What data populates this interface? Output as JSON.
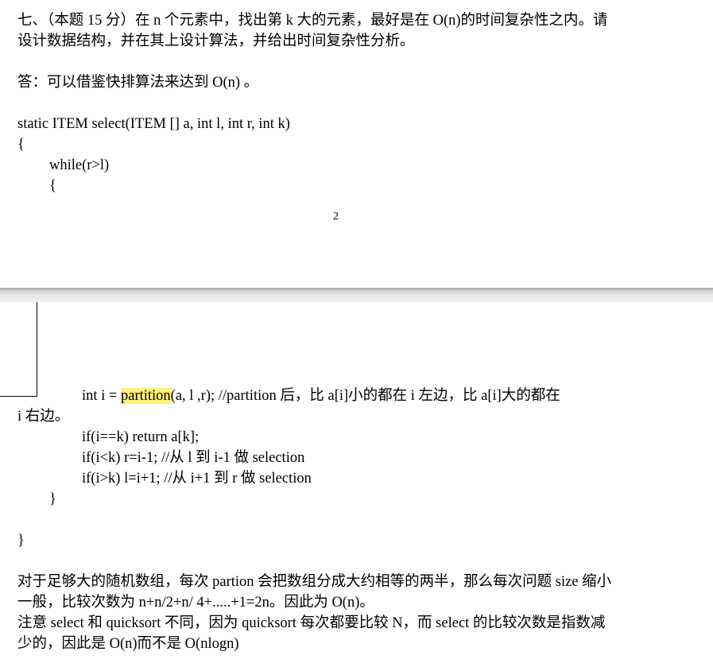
{
  "page1": {
    "question_line1": "七、（本题 15 分）在 n 个元素中，找出第 k 大的元素，最好是在 O(n)的时间复杂性之内。请",
    "question_line2": "设计数据结构，并在其上设计算法，并给出时间复杂性分析。",
    "answer_line": "答：可以借鉴快排算法来达到 O(n) 。",
    "code_signature": "static ITEM select(ITEM [] a, int l, int r, int k)",
    "code_open_brace": "{",
    "code_while": "while(r>l)",
    "code_while_brace": "{",
    "page_number": "2"
  },
  "page2": {
    "code_partition_prefix": "int i = ",
    "code_partition_highlight": "partition",
    "code_partition_suffix": "(a, l ,r); //partition 后，比 a[i]小的都在 i 左边，比 a[i]大的都在",
    "code_partition_wrap": "i 右边。",
    "code_if_equal": "if(i==k) return a[k];",
    "code_if_less": "if(i<k) r=i-1; //从 l 到 i-1 做 selection",
    "code_if_greater": "if(i>k) l=i+1; //从 i+1 到 r 做 selection",
    "code_close_inner": "}",
    "code_close_outer": "}",
    "analysis_line1": "对于足够大的随机数组，每次 partion 会把数组分成大约相等的两半，那么每次问题 size 缩小",
    "analysis_line2": "一般，比较次数为 n+n/2+n/ 4+.....+1=2n。因此为 O(n)。",
    "analysis_line3": "注意 select 和 quicksort 不同，因为 quicksort 每次都要比较 N，而 select 的比较次数是指数减",
    "analysis_line4": "少的，因此是 O(n)而不是 O(nlogn)"
  },
  "colors": {
    "highlight": "#fff176",
    "page_gap": "#cfcfcf"
  }
}
